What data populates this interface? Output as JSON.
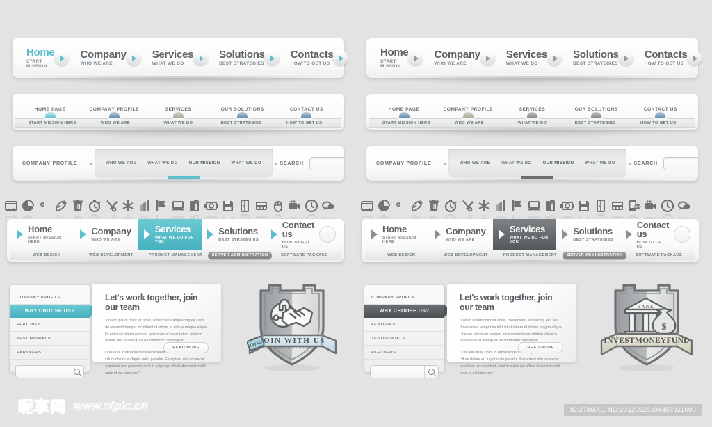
{
  "page": {
    "background": "#e3e3e3",
    "accent_color": "#5cc0cc",
    "gray_accent_color": "#7c8082"
  },
  "watermark": {
    "logo_text": "昵享网",
    "url": "www.nipic.cn",
    "id_label": "ID:2786001 NO:20120525194458921000"
  },
  "main_nav": {
    "items": [
      {
        "title": "Home",
        "subtitle": "START MISSION",
        "active": true
      },
      {
        "title": "Company",
        "subtitle": "WHO WE ARE",
        "active": false
      },
      {
        "title": "Services",
        "subtitle": "WHAT WE DO",
        "active": false
      },
      {
        "title": "Solutions",
        "subtitle": "BEST STRATEGIES",
        "active": false
      },
      {
        "title": "Contacts",
        "subtitle": "HOW TO GET US",
        "active": false
      }
    ],
    "arrow_icon": "play-arrow-icon"
  },
  "breadcrumb_nav": {
    "top": [
      "HOME PAGE",
      "COMPANY PROFILE",
      "SERVICES",
      "OUR SOLUTIONS",
      "CONTACT US"
    ],
    "bottom": [
      "START MISSION HERE",
      "WHO WE ARE",
      "WHAT WE DO",
      "BEST STRATEGIES",
      "HOW TO GET US"
    ],
    "dot_colors": [
      "#5cc0cc",
      "#5f86a6",
      "#a9a492",
      "#5f86a6",
      "#5f86a6"
    ]
  },
  "profile_bar": {
    "label": "COMPANY PROFILE",
    "prev_icon": "chevron-left-icon",
    "next_icon": "chevron-right-icon",
    "tabs": [
      {
        "label": "WHO WE ARE",
        "active": false
      },
      {
        "label": "WHAT WE DO",
        "active": false
      },
      {
        "label": "OUR MISSION",
        "active": true
      },
      {
        "label": "WHAT WE DO",
        "active": false
      }
    ],
    "search_label": "SEARCH",
    "search_value": "",
    "search_placeholder": "",
    "search_icon": "magnifier-icon"
  },
  "icon_strip": {
    "left_icons": [
      "browser-window-icon",
      "pie-chart-icon",
      "heart-icon",
      "palette-icon",
      "trash-bin-icon",
      "stopwatch-icon",
      "tools-icon",
      "asterisk-icon",
      "bar-chart-icon",
      "flag-icon",
      "laptop-icon",
      "books-icon",
      "film-reel-icon",
      "floppy-disk-icon",
      "door-icon",
      "calculator-icon",
      "computer-mouse-icon",
      "video-camera-icon",
      "clock-icon",
      "speech-bubbles-icon",
      "feather-pen-icon"
    ],
    "right_icons": [
      "browser-window-icon",
      "pie-chart-icon",
      "heart-icon",
      "palette-icon",
      "trash-bin-icon",
      "stopwatch-icon",
      "tools-icon",
      "asterisk-icon",
      "bar-chart-icon",
      "flag-icon",
      "laptop-icon",
      "books-icon",
      "film-reel-icon",
      "floppy-disk-icon",
      "door-icon",
      "calculator-icon",
      "sms-message-icon",
      "video-camera-icon",
      "clock-icon",
      "speech-bubbles-icon",
      "feather-pen-icon"
    ]
  },
  "services_nav": {
    "items": [
      {
        "title": "Home",
        "subtitle": "START MISSION HERE",
        "selected": false
      },
      {
        "title": "Company",
        "subtitle": "WHO WE ARE",
        "selected": false
      },
      {
        "title": "Services",
        "subtitle": "WHAT WE DO FOR YOU",
        "selected": true
      },
      {
        "title": "Solutions",
        "subtitle": "BEST STRATEGIES",
        "selected": false
      },
      {
        "title": "Contact us",
        "subtitle": "HOW TO GET US",
        "selected": false
      }
    ],
    "arrow_icon": "play-arrow-icon",
    "toggle_icon": "circle-button-icon",
    "subnav": [
      {
        "label": "WEB DESIGN",
        "highlight": false
      },
      {
        "label": "WEB DEVELOPMENT",
        "highlight": false
      },
      {
        "label": "PRODUCT MANAGEMENT",
        "highlight": false
      },
      {
        "label": "SERVER ADMINISTRATION",
        "highlight": true
      },
      {
        "label": "SOFTWARE PACKAGE",
        "highlight": false
      }
    ]
  },
  "content_module": {
    "sidebar_items": [
      {
        "label": "COMPANY PROFILE",
        "selected": false
      },
      {
        "label": "WHY CHOOSE US?",
        "selected": true
      },
      {
        "label": "FEATURES",
        "selected": false
      },
      {
        "label": "TESTIMONIALS",
        "selected": false
      },
      {
        "label": "PARTNERS",
        "selected": false
      }
    ],
    "sidebar_search_value": "",
    "sidebar_search_icon": "magnifier-icon",
    "heading": "Let's work together, join our team",
    "paragraph_1": "\"Lorem ipsum dolor sit amet, consectetur adipisicing elit, sed do eiusmod tempor incididunt ut labore et dolore magna aliqua. Ut enim ad minim veniam, quis nostrud exercitation ullamco laboris nisi ut aliquip ex ea commodo consequat.",
    "paragraph_2": "Duis aute irure dolor in reprehenderit in voluptate velit esse cillum dolore eu fugiat nulla pariatur. Excepteur sint occaecat cupidatat non proident, sunt in culpa qui officia deserunt mollit anim id est laborum.\"",
    "read_more_label": "READ MORE"
  },
  "badge_left": {
    "name": "join-with-us-shield-badge",
    "banner_text": "JOIN WITH US",
    "sub_text": "GOLD BUSINESS COMPANY",
    "tag_text": "TAG",
    "symbols": [
      "handshake-icon",
      "padlock-icon",
      "key-icon"
    ]
  },
  "badge_right": {
    "name": "investmoneyfund-shield-badge",
    "building_label": "BANK",
    "banner_text": "INVESTMONEYFUND",
    "money_symbol": "$",
    "symbols": [
      "bank-building-icon",
      "money-bag-icon"
    ]
  }
}
